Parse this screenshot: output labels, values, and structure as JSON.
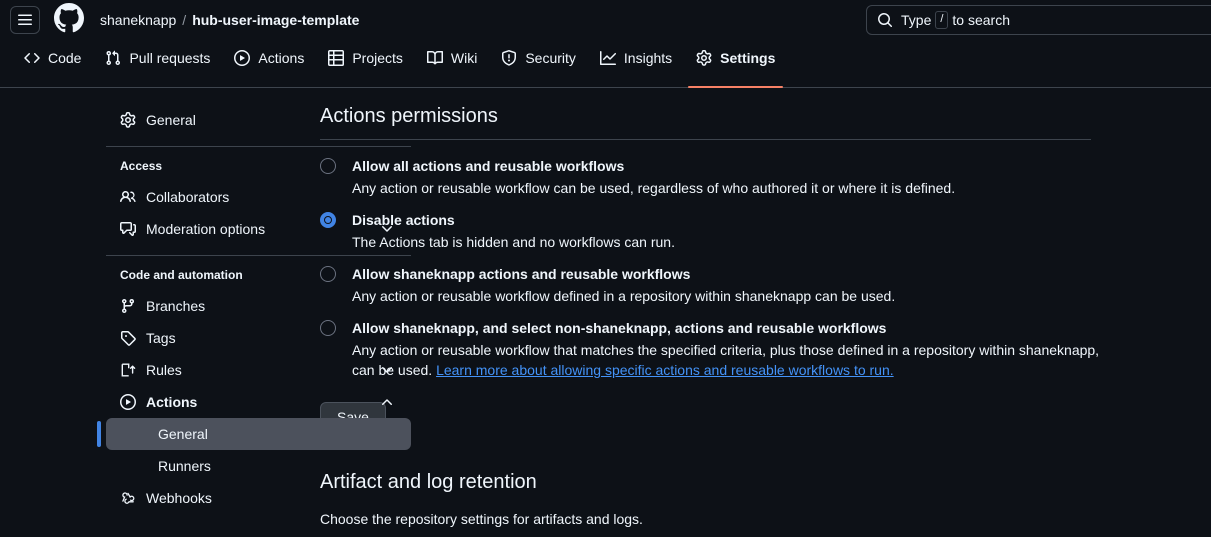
{
  "header": {
    "menu_icon": "hamburger-icon",
    "logo_icon": "github-mark-icon",
    "breadcrumb": {
      "owner": "shaneknapp",
      "separator": "/",
      "repo": "hub-user-image-template"
    },
    "search": {
      "icon": "search-icon",
      "prefix": "Type",
      "key": "/",
      "suffix": "to search"
    }
  },
  "repo_tabs": [
    {
      "label": "Code",
      "icon": "code-icon",
      "active": false
    },
    {
      "label": "Pull requests",
      "icon": "git-pull-request-icon",
      "active": false
    },
    {
      "label": "Actions",
      "icon": "play-circle-icon",
      "active": false
    },
    {
      "label": "Projects",
      "icon": "table-icon",
      "active": false
    },
    {
      "label": "Wiki",
      "icon": "book-icon",
      "active": false
    },
    {
      "label": "Security",
      "icon": "shield-icon",
      "active": false
    },
    {
      "label": "Insights",
      "icon": "graph-icon",
      "active": false
    },
    {
      "label": "Settings",
      "icon": "gear-icon",
      "active": true
    }
  ],
  "sidebar": {
    "top_items": [
      {
        "label": "General",
        "icon": "gear-icon",
        "selected": false,
        "chevron": null
      }
    ],
    "sections": [
      {
        "heading": "Access",
        "items": [
          {
            "label": "Collaborators",
            "icon": "people-icon",
            "selected": false,
            "chevron": null
          },
          {
            "label": "Moderation options",
            "icon": "comment-discussion-icon",
            "selected": false,
            "chevron": "chevron-down-icon"
          }
        ]
      },
      {
        "heading": "Code and automation",
        "items": [
          {
            "label": "Branches",
            "icon": "git-branch-icon",
            "selected": false,
            "chevron": null
          },
          {
            "label": "Tags",
            "icon": "tag-icon",
            "selected": false,
            "chevron": null
          },
          {
            "label": "Rules",
            "icon": "rule-icon",
            "selected": false,
            "chevron": "chevron-down-icon"
          },
          {
            "label": "Actions",
            "icon": "play-circle-icon",
            "selected": false,
            "chevron": "chevron-up-icon",
            "bold": true
          },
          {
            "label": "General",
            "icon": null,
            "selected": true,
            "chevron": null,
            "sub": true
          },
          {
            "label": "Runners",
            "icon": null,
            "selected": false,
            "chevron": null,
            "sub": true
          },
          {
            "label": "Webhooks",
            "icon": "webhook-icon",
            "selected": false,
            "chevron": null
          }
        ]
      }
    ]
  },
  "main": {
    "title": "Actions permissions",
    "permissions": [
      {
        "label": "Allow all actions and reusable workflows",
        "description": "Any action or reusable workflow can be used, regardless of who authored it or where it is defined.",
        "checked": false
      },
      {
        "label": "Disable actions",
        "description": "The Actions tab is hidden and no workflows can run.",
        "checked": true
      },
      {
        "label": "Allow shaneknapp actions and reusable workflows",
        "description": "Any action or reusable workflow defined in a repository within shaneknapp can be used.",
        "checked": false
      },
      {
        "label": "Allow shaneknapp, and select non-shaneknapp, actions and reusable workflows",
        "description": "Any action or reusable workflow that matches the specified criteria, plus those defined in a repository within shaneknapp, can be used. ",
        "link_text": "Learn more about allowing specific actions and reusable workflows to run.",
        "checked": false
      }
    ],
    "save_label": "Save",
    "retention": {
      "title": "Artifact and log retention",
      "description": "Choose the repository settings for artifacts and logs."
    }
  },
  "colors": {
    "background": "#0d1117",
    "border": "#3d444d",
    "text": "#f0f6fc",
    "accent_blue": "#4184e4",
    "link": "#4493f8",
    "active_tab_underline": "#f78166",
    "selected_nav_bg": "#4c515c"
  }
}
